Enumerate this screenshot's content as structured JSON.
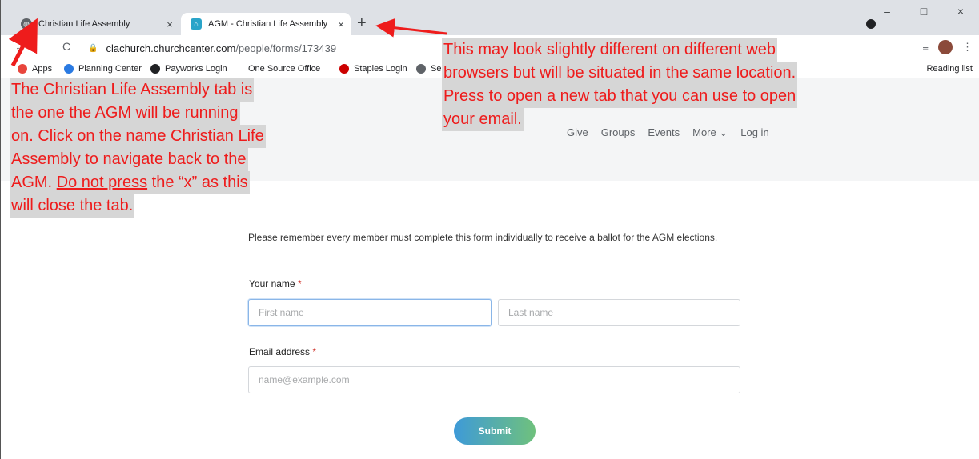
{
  "browser": {
    "tabs": [
      {
        "label": "Christian Life Assembly",
        "close": "×"
      },
      {
        "label": "AGM - Christian Life Assembly",
        "close": "×"
      }
    ],
    "new_tab": "+",
    "window_controls": {
      "minimize": "–",
      "maximize": "□",
      "close": "×"
    },
    "nav": {
      "back": "←",
      "reload": "C"
    },
    "url": {
      "host": "clachurch.churchcenter.com",
      "path": "/people/forms/173439"
    },
    "toolbar_icons": [
      "reading-mode-icon",
      "avatar",
      "more-icon"
    ],
    "toolbar_glyphs": {
      "reading_mode": "≡",
      "more": "⋮"
    },
    "bookmarks": [
      {
        "label": "Apps",
        "color": "#e8453c"
      },
      {
        "label": "Planning Center",
        "color": "#2a7ae2"
      },
      {
        "label": "Payworks Login",
        "color": "#202124"
      },
      {
        "label": "One Source Office",
        "color": "#ffffff"
      },
      {
        "label": "Staples Login",
        "color": "#cc0000"
      },
      {
        "label": "Se",
        "color": "#5f6368"
      }
    ],
    "reading_list": "Reading list"
  },
  "site_nav": [
    "Give",
    "Groups",
    "Events",
    "More ⌄",
    "Log in"
  ],
  "form": {
    "intro": "Please remember every member must complete this form individually to receive a ballot for the AGM elections.",
    "name_label": "Your name",
    "required_mark": "*",
    "first_name_placeholder": "First name",
    "last_name_placeholder": "Last name",
    "email_label": "Email address",
    "email_placeholder": "name@example.com",
    "submit": "Submit"
  },
  "annotations": {
    "left_lines": [
      "The Christian Life Assembly tab is",
      "the one the AGM will be running",
      "on. Click on the name Christian Life",
      "Assembly to navigate back to the"
    ],
    "left_line5_prefix": "AGM.",
    "left_line5_underlined": "Do not press",
    "left_line5_suffix": "the “x” as this",
    "left_line6": "will close the tab.",
    "right_lines": [
      "This may look slightly different on different web",
      "browsers but will be situated in the same location.",
      "Press to open a new tab that you can use to open",
      "your email."
    ]
  },
  "colors": {
    "annotation": "#ee1c1c",
    "annotation_bg": "#d6d6d6",
    "submit_start": "#3e9ad8",
    "submit_end": "#6fc17d"
  }
}
